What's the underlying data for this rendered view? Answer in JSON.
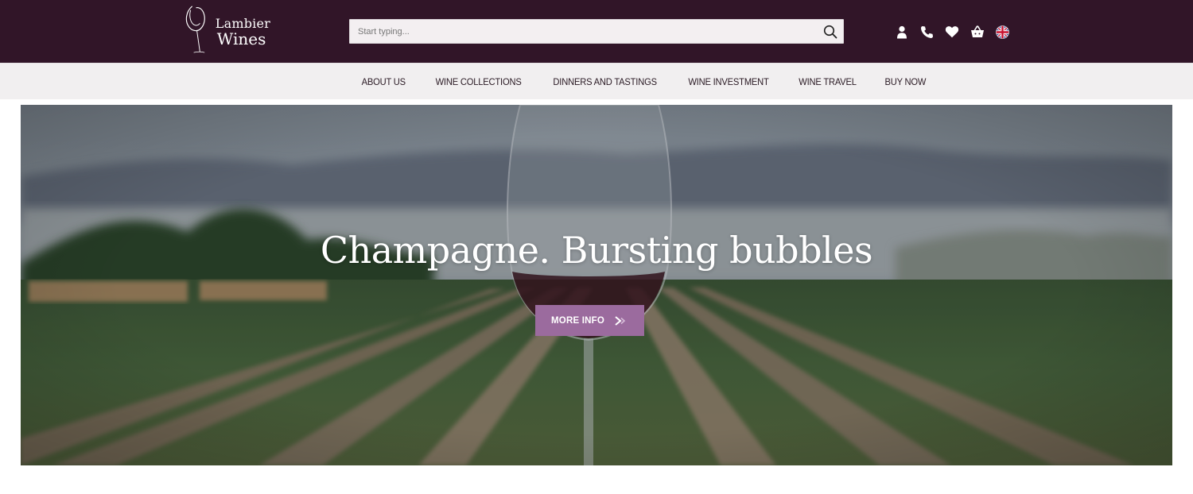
{
  "brand": {
    "line1": "Lambier",
    "line2": "Wines"
  },
  "search": {
    "placeholder": "Start typing...",
    "value": ""
  },
  "header_icons": [
    "user-icon",
    "phone-icon",
    "heart-icon",
    "basket-icon",
    "uk-flag-icon"
  ],
  "nav": {
    "items": [
      {
        "label": "ABOUT US"
      },
      {
        "label": "WINE COLLECTIONS"
      },
      {
        "label": "DINNERS AND TASTINGS"
      },
      {
        "label": "WINE INVESTMENT"
      },
      {
        "label": "WINE TRAVEL"
      },
      {
        "label": "BUY NOW"
      }
    ]
  },
  "hero": {
    "title": "Champagne. Bursting bubbles",
    "button_label": "MORE INFO"
  },
  "colors": {
    "header_bg": "#311528",
    "nav_bg": "#f1eff0",
    "button_bg": "#9b6b9e"
  }
}
